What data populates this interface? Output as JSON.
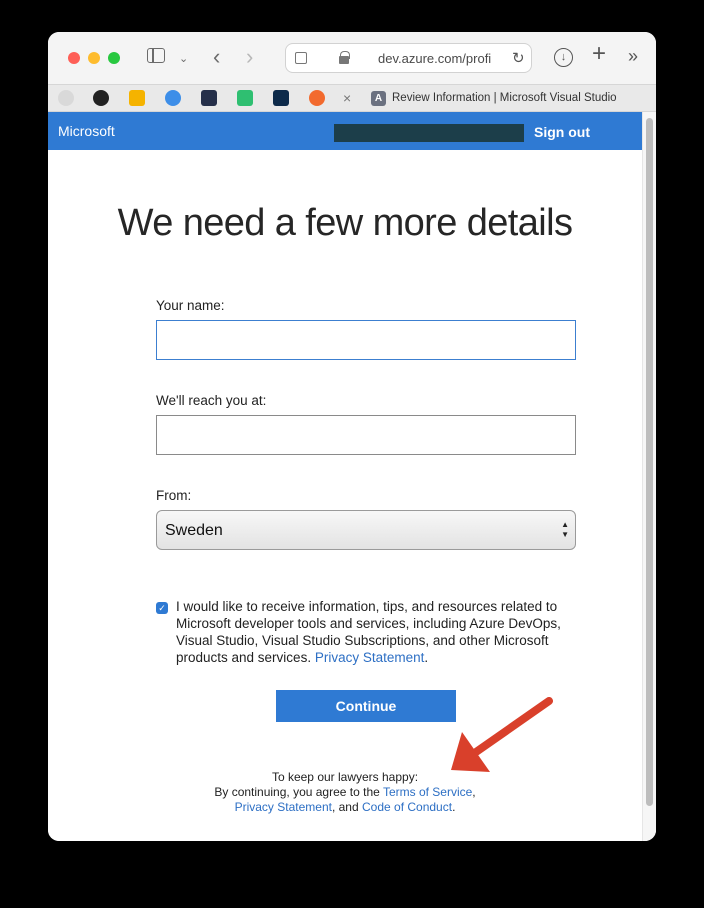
{
  "browser": {
    "url": "dev.azure.com/profi",
    "active_tab_title": "Review Information | Microsoft Visual Studio",
    "active_tab_favicon": "A"
  },
  "header": {
    "brand": "Microsoft",
    "sign_out": "Sign out"
  },
  "form": {
    "heading": "We need a few more details",
    "name_label": "Your name:",
    "name_value": "",
    "email_label": "We'll reach you at:",
    "email_value": "",
    "country_label": "From:",
    "country_value": "Sweden",
    "consent_checked": true,
    "consent_text": "I would like to receive information, tips, and resources related to Microsoft developer tools and services, including Azure DevOps, Visual Studio, Visual Studio Subscriptions, and other Microsoft products and services.",
    "consent_link": "Privacy Statement",
    "continue_label": "Continue"
  },
  "footer": {
    "line1": "To keep our lawyers happy:",
    "line2_prefix": "By continuing, you agree to the",
    "terms_link": "Terms of Service",
    "privacy_link": "Privacy Statement",
    "and_text": ", and",
    "conduct_link": "Code of Conduct"
  },
  "colors": {
    "accent": "#2f7ad3",
    "annotation_arrow": "#d9402b"
  }
}
